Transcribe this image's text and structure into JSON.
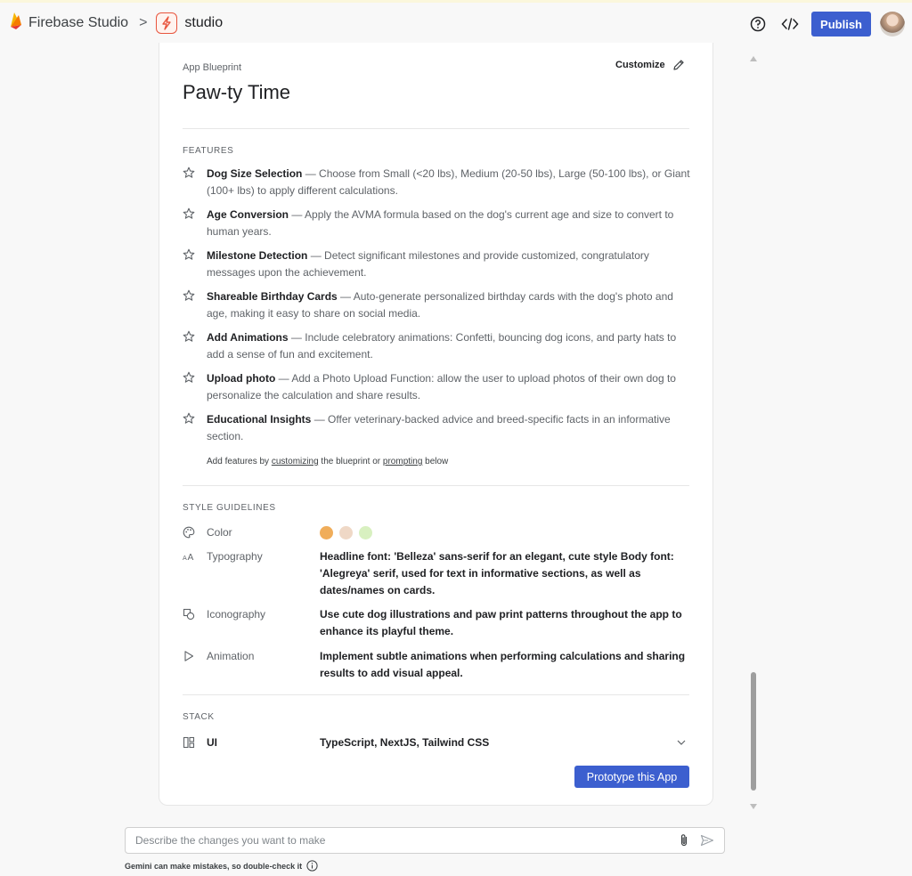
{
  "header": {
    "brand_name": "Firebase Studio",
    "crumb_separator": ">",
    "project_name": "studio",
    "publish_label": "Publish"
  },
  "blueprint": {
    "label": "App Blueprint",
    "customize_label": "Customize",
    "title": "Paw-ty Time",
    "features_heading": "FEATURES",
    "features": [
      {
        "name": "Dog Size Selection",
        "desc": " — Choose from Small (<20 lbs), Medium (20-50 lbs), Large (50-100 lbs), or Giant (100+ lbs) to apply different calculations."
      },
      {
        "name": "Age Conversion",
        "desc": " — Apply the AVMA formula based on the dog's current age and size to convert to human years."
      },
      {
        "name": "Milestone Detection",
        "desc": " — Detect significant milestones and provide customized, congratulatory messages upon the achievement."
      },
      {
        "name": "Shareable Birthday Cards",
        "desc": " — Auto-generate personalized birthday cards with the dog's photo and age, making it easy to share on social media."
      },
      {
        "name": "Add Animations",
        "desc": " — Include celebratory animations: Confetti, bouncing dog icons, and party hats to add a sense of fun and excitement."
      },
      {
        "name": "Upload photo",
        "desc": " — Add a Photo Upload Function: allow the user to upload photos of their own dog to personalize the calculation and share results."
      },
      {
        "name": "Educational Insights",
        "desc": " — Offer veterinary-backed advice and breed-specific facts in an informative section."
      }
    ],
    "add_hint": {
      "prefix": "Add features by ",
      "link1": "customizing",
      "middle": " the blueprint or ",
      "link2": "prompting",
      "suffix": " below"
    },
    "style_heading": "STYLE GUIDELINES",
    "style": {
      "color_label": "Color",
      "colors": [
        "#f0ad5a",
        "#efd8c6",
        "#d8f0c0"
      ],
      "typography_label": "Typography",
      "typography_value": "Headline font: 'Belleza' sans-serif for an elegant, cute style Body font: 'Alegreya' serif, used for text in informative sections, as well as dates/names on cards.",
      "iconography_label": "Iconography",
      "iconography_value": "Use cute dog illustrations and paw print patterns throughout the app to enhance its playful theme.",
      "animation_label": "Animation",
      "animation_value": "Implement subtle animations when performing calculations and sharing results to add visual appeal."
    },
    "stack_heading": "STACK",
    "stack": {
      "ui_label": "UI",
      "ui_value": "TypeScript, NextJS, Tailwind CSS"
    },
    "prototype_label": "Prototype this App"
  },
  "prompt": {
    "placeholder": "Describe the changes you want to make",
    "disclaimer": "Gemini can make mistakes, so double-check it"
  }
}
